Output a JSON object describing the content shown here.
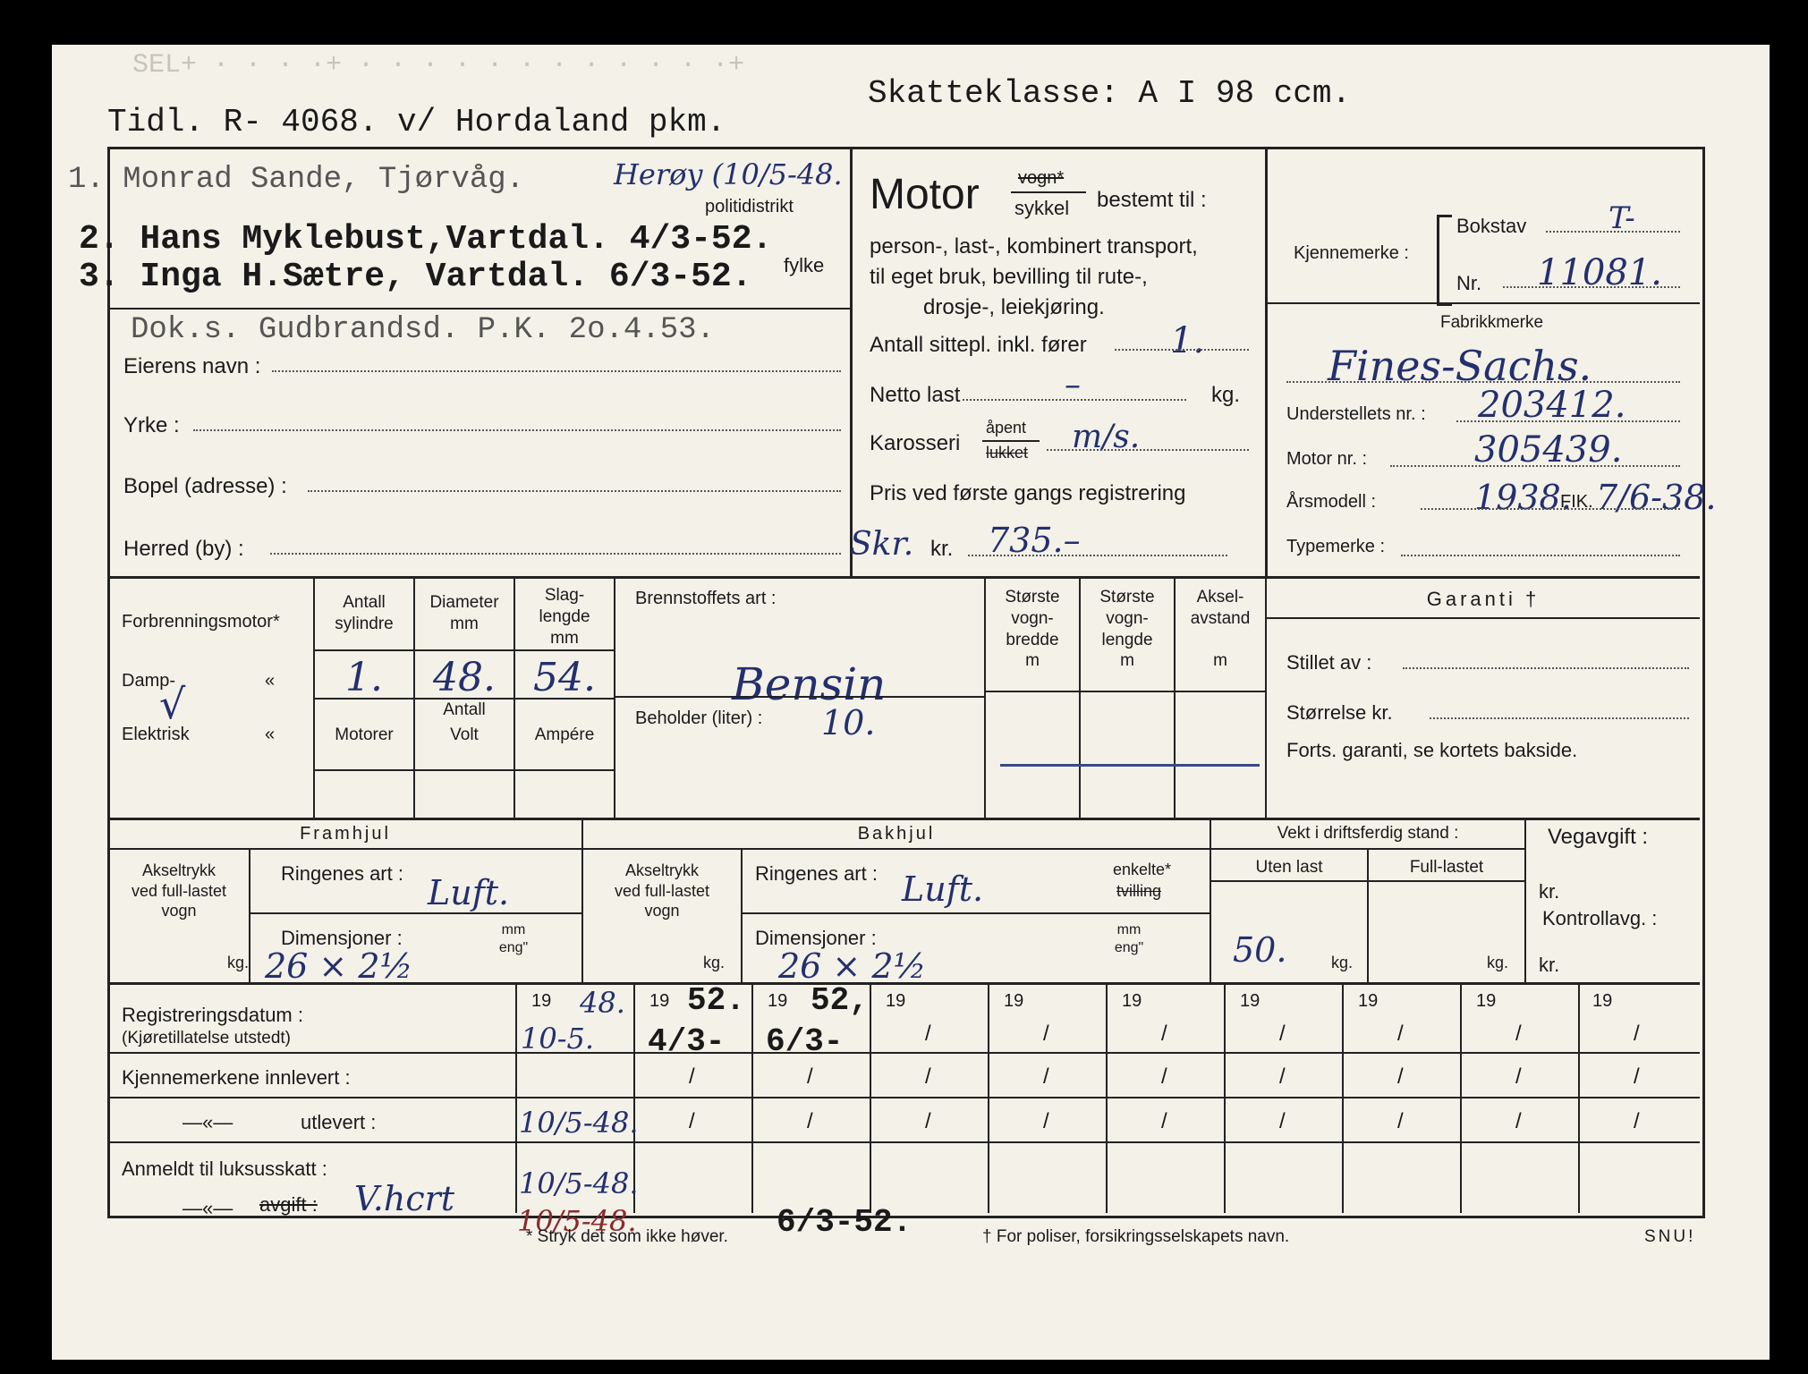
{
  "header": {
    "faded": "SEL+ · · · ·+ · · · · · · · · · · · ·+",
    "previous_registration": "Tidl. R- 4068. v/ Hordaland pkm.",
    "tax_class": "Skatteklasse: A I 98 ccm."
  },
  "owners": [
    {
      "typed": "1. Monrad Sande, Tjørvåg.",
      "handwritten": "Herøy (10/5-48."
    },
    {
      "typed": "2. Hans Myklebust,Vartdal. 4/3-52."
    },
    {
      "typed": "3. Inga H.Sætre, Vartdal. 6/3-52."
    },
    {
      "typed": "Dok.s. Gudbrandsd. P.K. 2o.4.53."
    }
  ],
  "labels": {
    "politidistrikt": "politidistrikt",
    "fylke": "fylke",
    "eierens_navn": "Eierens navn :",
    "yrke": "Yrke :",
    "bopel": "Bopel (adresse) :",
    "herred": "Herred (by) :"
  },
  "motor": {
    "title": "Motor",
    "vogn": "vogn*",
    "sykkel": "sykkel",
    "bestemt_til": "bestemt til :",
    "use_1": "person-, last-, kombinert transport,",
    "use_2": "til eget bruk, bevilling til rute-,",
    "use_3": "drosje-, leiekjøring.",
    "seats_label": "Antall sittepl. inkl. fører",
    "seats_value": "1.",
    "netto_last_label": "Netto last",
    "netto_last_value": "–",
    "kg": "kg.",
    "karosseri_label": "Karosseri",
    "apent": "åpent",
    "lukket": "lukket",
    "karosseri_value": "m/s.",
    "price_label": "Pris ved første gangs registrering",
    "price_currency": "Skr.",
    "kr": "kr.",
    "price_value": "735.–"
  },
  "plate": {
    "label": "Kjennemerke :",
    "bokstav_label": "Bokstav",
    "bokstav_value": "T-",
    "nr_label": "Nr.",
    "nr_value": "11081."
  },
  "vehicle": {
    "fabrikkmerke_label": "Fabrikkmerke",
    "fabrikkmerke_value": "Fines-Sachs.",
    "understell_label": "Understellets nr. :",
    "understell_value": "203412.",
    "motor_nr_label": "Motor nr. :",
    "motor_nr_value": "305439.",
    "arsmodell_label": "Årsmodell :",
    "arsmodell_value": "1938.",
    "fik_label": "FIK.",
    "fik_value": "7/6-38.",
    "typemerke_label": "Typemerke :"
  },
  "engine": {
    "forbrenning": "Forbrenningsmotor*",
    "damp": "Damp-",
    "elektrisk": "Elektrisk",
    "ditto": "«",
    "check": "√",
    "cyl_header": "Antall\nsylindre",
    "dia_header": "Diameter\nmm",
    "stroke_header": "Slag-\nlengde\nmm",
    "cylinders": "1.",
    "diameter": "48.",
    "stroke": "54.",
    "antall": "Antall",
    "motorer": "Motorer",
    "volt": "Volt",
    "ampere": "Ampére",
    "fuel_label": "Brennstoffets art :",
    "fuel_value": "Bensin",
    "tank_label": "Beholder (liter) :",
    "tank_value": "10.",
    "width_header": "Største\nvogn-\nbredde\nm",
    "length_header": "Største\nvogn-\nlengde\nm",
    "axle_header": "Aksel-\navstand\n\nm"
  },
  "guarantee": {
    "title": "Garanti †",
    "stillet_av": "Stillet av :",
    "storrelse": "Størrelse kr.",
    "note": "Forts. garanti, se kortets bakside."
  },
  "wheels": {
    "front_title": "Framhjul",
    "rear_title": "Bakhjul",
    "axle_load": "Akseltrykk\nved full-lastet\nvogn",
    "kg": "kg.",
    "tyre_label": "Ringenes art :",
    "front_tyre": "Luft.",
    "rear_tyre": "Luft.",
    "enkelte": "enkelte*",
    "tvilling": "tvilling",
    "dim_label": "Dimensjoner :",
    "dim_unit": "mm\neng\"",
    "front_dim": "26 × 2½",
    "rear_dim": "26 × 2½"
  },
  "weight": {
    "title": "Vekt i driftsferdig stand :",
    "uten_last": "Uten last",
    "full_last": "Full-lastet",
    "uten_last_value": "50."
  },
  "tax": {
    "vegavgift": "Vegavgift :",
    "kr": "kr.",
    "kontrollavg": "Kontrollavg. :"
  },
  "registration": {
    "date_label": "Registreringsdatum :",
    "date_sublabel": "(Kjøretillatelse utstedt)",
    "innlevert": "Kjennemerkene innlevert :",
    "ditto": "—«—",
    "utlevert": "utlevert :",
    "luksus": "Anmeldt til luksusskatt :",
    "avgift": "avgift :",
    "avgift_note": "V.hcrt",
    "year_prefix": "19",
    "cols": [
      {
        "year": "48.",
        "date": "10-5.",
        "utlevert": "10/5-48.",
        "luksus": "10/5-48.",
        "avgift": "10/5-48."
      },
      {
        "year": "52.",
        "date": "4/3-"
      },
      {
        "year": "52,",
        "date": "6/3-",
        "avgift": "6/3-52."
      }
    ]
  },
  "footer": {
    "asterisk": "* Stryk det som ikke høver.",
    "dagger": "† For poliser, forsikringsselskapets navn.",
    "snu": "SNU!"
  }
}
